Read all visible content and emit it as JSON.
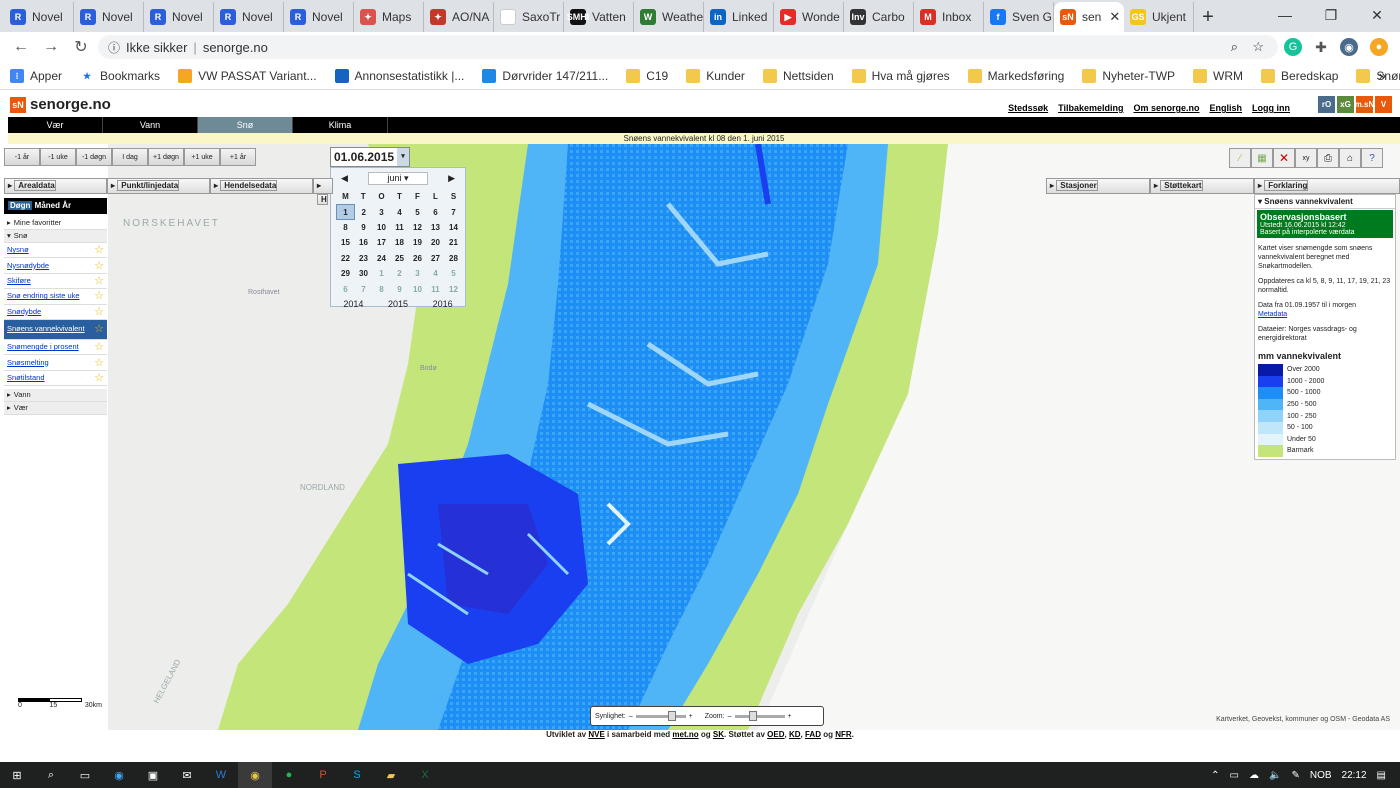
{
  "browser": {
    "tabs": [
      {
        "label": "Novel",
        "color": "#2b5ed8",
        "glyph": "R"
      },
      {
        "label": "Novel",
        "color": "#2b5ed8",
        "glyph": "R"
      },
      {
        "label": "Novel",
        "color": "#2b5ed8",
        "glyph": "R"
      },
      {
        "label": "Novel",
        "color": "#2b5ed8",
        "glyph": "R"
      },
      {
        "label": "Novel",
        "color": "#2b5ed8",
        "glyph": "R"
      },
      {
        "label": "Maps",
        "color": "#d9534f",
        "glyph": "✦"
      },
      {
        "label": "AO/NA",
        "color": "#c0392b",
        "glyph": "✦"
      },
      {
        "label": "SaxoTr",
        "color": "#ffffff",
        "glyph": ""
      },
      {
        "label": "Vatten",
        "color": "#111111",
        "glyph": "SMHI"
      },
      {
        "label": "Weathe",
        "color": "#2e7d32",
        "glyph": "W"
      },
      {
        "label": "Linked",
        "color": "#0a66c2",
        "glyph": "in"
      },
      {
        "label": "Wonde",
        "color": "#e52d27",
        "glyph": "▶"
      },
      {
        "label": "Carbo",
        "color": "#333333",
        "glyph": "Inv"
      },
      {
        "label": "Inbox",
        "color": "#d93025",
        "glyph": "M"
      },
      {
        "label": "Sven G",
        "color": "#1877f2",
        "glyph": "f"
      },
      {
        "label": "sen",
        "color": "#e8590c",
        "glyph": "sN",
        "active": true
      },
      {
        "label": "Ukjent",
        "color": "#f5c518",
        "glyph": "GS"
      }
    ],
    "new_tab": "+",
    "url_label": "Ikke sikker",
    "url": "senorge.no",
    "bookmarks": [
      {
        "label": "Apper",
        "type": "apps"
      },
      {
        "label": "Bookmarks",
        "type": "star"
      },
      {
        "label": "VW PASSAT Variant...",
        "type": "orange"
      },
      {
        "label": "Annonsestatistikk |...",
        "type": "blue"
      },
      {
        "label": "Dørvrider 147/211...",
        "type": "blue2"
      },
      {
        "label": "C19",
        "type": "folder"
      },
      {
        "label": "Kunder",
        "type": "folder"
      },
      {
        "label": "Nettsiden",
        "type": "folder"
      },
      {
        "label": "Hva må gjøres",
        "type": "folder"
      },
      {
        "label": "Markedsføring",
        "type": "folder"
      },
      {
        "label": "Nyheter-TWP",
        "type": "folder"
      },
      {
        "label": "WRM",
        "type": "folder"
      },
      {
        "label": "Beredskap",
        "type": "folder"
      },
      {
        "label": "Snøradar",
        "type": "folder"
      }
    ],
    "more": "»"
  },
  "site": {
    "logo": "senorge.no",
    "logo_mark": "sN",
    "top_links": [
      "Stedssøk",
      "Tilbakemelding",
      "Om senorge.no",
      "English",
      "Logg inn"
    ],
    "partners": [
      {
        "t": "rO",
        "c": "#4a6b8a"
      },
      {
        "t": "xG",
        "c": "#5b8a3c"
      },
      {
        "t": "m.sN",
        "c": "#e8590c"
      },
      {
        "t": "V",
        "c": "#e8590c"
      }
    ],
    "nav": [
      "Vær",
      "Vann",
      "Snø",
      "Klima"
    ],
    "nav_active": "Snø",
    "info": "Snøens vannekvivalent kl 08  den 1. juni 2015",
    "steps": [
      "-1 år",
      "-1 uke",
      "-1 døgn",
      "I dag",
      "+1 døgn",
      "+1 uke",
      "+1 år"
    ],
    "date_value": "01.06.2015",
    "calendar": {
      "month": "juni",
      "weekdays": [
        "M",
        "T",
        "O",
        "T",
        "F",
        "L",
        "S"
      ],
      "weeks": [
        [
          "1",
          "2",
          "3",
          "4",
          "5",
          "6",
          "7"
        ],
        [
          "8",
          "9",
          "10",
          "11",
          "12",
          "13",
          "14"
        ],
        [
          "15",
          "16",
          "17",
          "18",
          "19",
          "20",
          "21"
        ],
        [
          "22",
          "23",
          "24",
          "25",
          "26",
          "27",
          "28"
        ],
        [
          "29",
          "30",
          "1",
          "2",
          "3",
          "4",
          "5"
        ],
        [
          "6",
          "7",
          "8",
          "9",
          "10",
          "11",
          "12"
        ]
      ],
      "years": [
        "2014",
        "2015",
        "2016"
      ]
    },
    "panel_tabs": [
      "Arealdata",
      "Punkt/linjedata",
      "Hendelsedata",
      "H"
    ],
    "right_tabs": [
      "Stasjoner",
      "Støttekart",
      "Forklaring"
    ],
    "period": [
      "Døgn",
      "Måned",
      "År"
    ],
    "favorites": "Mine favoritter",
    "section_sno": "Snø",
    "sno_items": [
      "Nysnø",
      "Nysnødybde",
      "Skiføre",
      "Snø endring siste uke",
      "Snødybde",
      "Snøens vannekvivalent",
      "Snømengde i prosent",
      "Snøsmelting",
      "Snøtilstand"
    ],
    "section_vann": "Vann",
    "section_vaer": "Vær"
  },
  "legend": {
    "head": "Snøens vannekvivalent",
    "obs_title": "Observasjonsbasert",
    "obs_issued": "Utstedt 16.06.2015 kl 12:42",
    "obs_basis": "Basert på interpolerte værdata",
    "text1": "Kartet viser snømengde som snøens vannekvivalent beregnet med Snøkartmodellen.",
    "text2": "Oppdateres ca kl 5, 8, 9, 11, 17, 19, 21, 23 normaltid.",
    "text3": "Data fra 01.09.1957 til i morgen",
    "meta": "Metadata",
    "text4": "Dataeier: Norges vassdrags- og energidirektorat",
    "unit_title": "mm vannekvivalent",
    "classes": [
      {
        "label": "Over 2000",
        "color": "#0a1aa8"
      },
      {
        "label": "1000 - 2000",
        "color": "#1a3ff0"
      },
      {
        "label": "500 - 1000",
        "color": "#1d8ef5"
      },
      {
        "label": "250 - 500",
        "color": "#4fb5f7"
      },
      {
        "label": "100 - 250",
        "color": "#8fd3f9"
      },
      {
        "label": "50 - 100",
        "color": "#bfe7f9"
      },
      {
        "label": "Under 50",
        "color": "#e2f4fa"
      },
      {
        "label": "Barmark",
        "color": "#c4e57a"
      }
    ]
  },
  "map": {
    "labels": [
      "NORSKEHAVET",
      "NORDLAND",
      "HELGELAND",
      "Bodø",
      "Rosthavet"
    ],
    "scale_labels": [
      "0",
      "15",
      "30km"
    ],
    "slider_visibility": "Synlighet:",
    "slider_zoom": "Zoom:",
    "credit": "Kartverket, Geovekst, kommuner og OSM - Geodata AS"
  },
  "footer": {
    "text_a": "Utviklet av",
    "nve": "NVE",
    "text_b": "i samarbeid med",
    "met": "met.no",
    "text_c": "og",
    "sk": "SK",
    "text_d": ". Støttet av",
    "oed": "OED",
    "kd": "KD",
    "fad": "FAD",
    "text_e": "og",
    "nfr": "NFR"
  },
  "taskbar": {
    "lang": "NOB",
    "time": "22:12"
  }
}
